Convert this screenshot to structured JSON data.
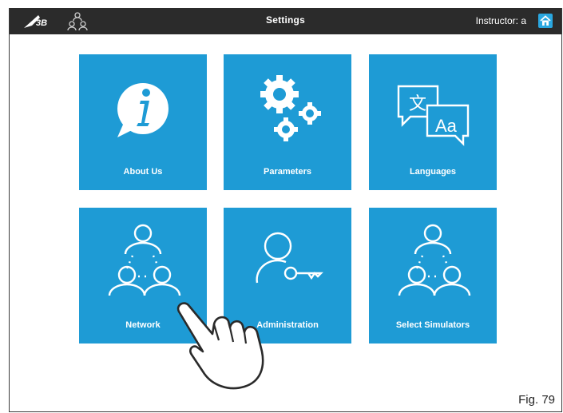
{
  "header": {
    "title": "Settings",
    "user_label": "Instructor: a"
  },
  "tiles": [
    {
      "label": "About Us",
      "icon": "info-icon"
    },
    {
      "label": "Parameters",
      "icon": "gears-icon"
    },
    {
      "label": "Languages",
      "icon": "languages-icon"
    },
    {
      "label": "Network",
      "icon": "network-icon"
    },
    {
      "label": "Administration",
      "icon": "user-key-icon"
    },
    {
      "label": "Select Simulators",
      "icon": "network-icon"
    }
  ],
  "figure_caption": "Fig. 79",
  "colors": {
    "topbar": "#2b2b2b",
    "tile": "#1e9bd5",
    "home_icon": "#2aa7e0"
  }
}
